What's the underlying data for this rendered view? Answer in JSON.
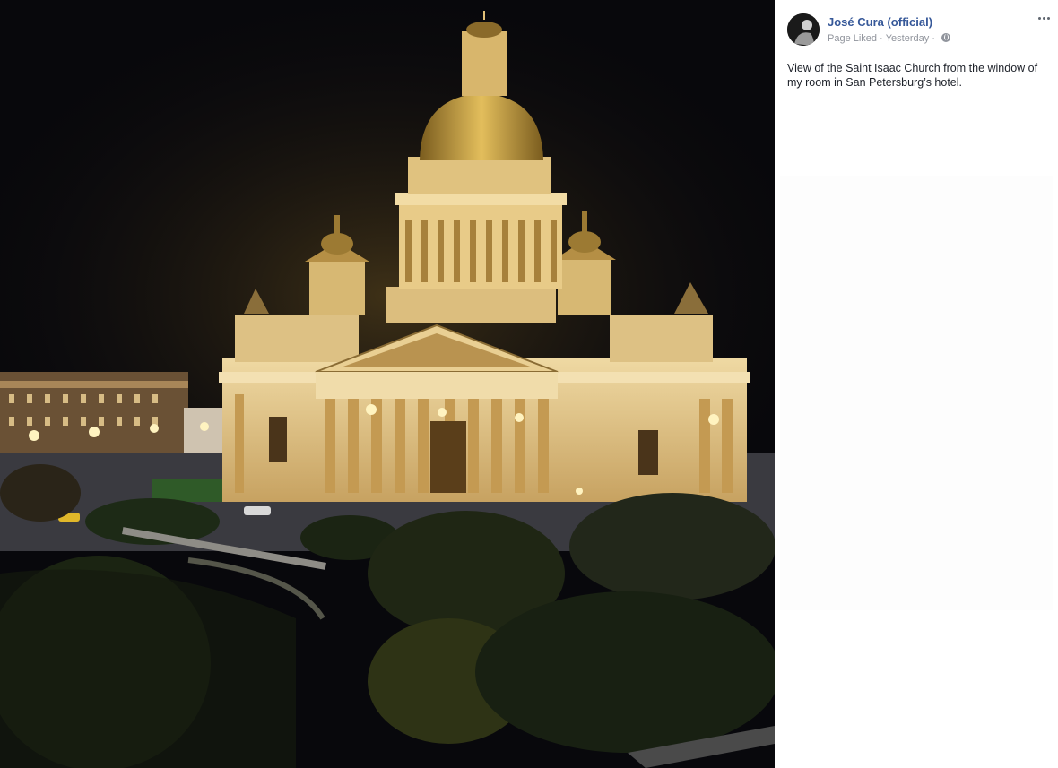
{
  "photo": {
    "subject": "Saint Isaac's Cathedral illuminated at night",
    "colors": {
      "sky": "#08080c",
      "facade": "#e8cc8a",
      "dome": "#c9a441",
      "trees": "#1f2614",
      "road": "#3a3a40"
    }
  },
  "post": {
    "author": "José Cura (official)",
    "status": "Page Liked",
    "separator": "·",
    "timestamp": "Yesterday",
    "audience_icon": "globe-icon",
    "more_icon": "ellipsis-icon",
    "caption": "View of the Saint Isaac Church from the window of my room in San Petersburg’s hotel."
  },
  "colors": {
    "link": "#365899",
    "meta": "#90949c",
    "text": "#1d2129"
  }
}
